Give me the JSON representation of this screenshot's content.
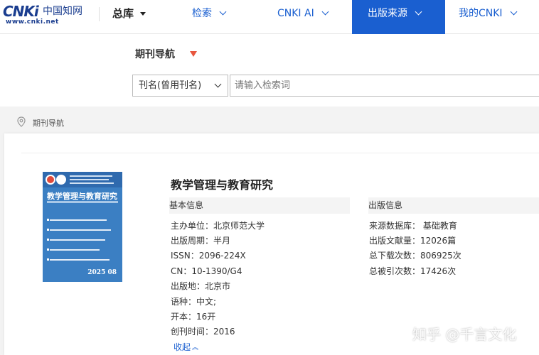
{
  "header": {
    "logo_brand": "CNKi",
    "logo_cn": "中国知网",
    "logo_url": "www.cnki.net",
    "nav": [
      {
        "label": "总库"
      },
      {
        "label": "检索"
      },
      {
        "label": "CNKI AI"
      },
      {
        "label": "出版来源"
      },
      {
        "label": "我的CNKI"
      }
    ]
  },
  "search": {
    "section_title": "期刊导航",
    "field_selected": "刊名(曾用刊名)",
    "placeholder": "请输入检索词"
  },
  "breadcrumb": "期刊导航",
  "journal": {
    "cover_title": "教学管理与教育研究",
    "cover_issue": "2025 08",
    "title": "教学管理与教育研究",
    "basic_head": "基本信息",
    "basic": [
      "主办单位：北京师范大学",
      "出版周期：半月",
      "ISSN：2096-224X",
      "CN：10-1390/G4",
      "出版地：北京市",
      "语种：中文;",
      "开本：16开",
      "创刊时间：2016"
    ],
    "pub_head": "出版信息",
    "pub": [
      "来源数据库： 基础教育",
      "出版文献量：12026篇",
      "总下载次数：806925次",
      "总被引次数：17426次"
    ],
    "collapse_label": "收起"
  },
  "watermark": "知乎 @千言文化",
  "colors": {
    "accent": "#1a5fd0",
    "caret": "#e8563e"
  }
}
